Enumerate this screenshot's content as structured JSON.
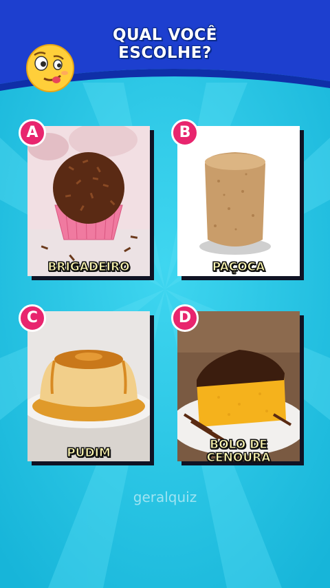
{
  "header": {
    "title_line1": "QUAL VOCÊ",
    "title_line2": "ESCOLHE?",
    "emoji_icon": "thinking-face-emoji"
  },
  "options": [
    {
      "letter": "A",
      "label": "BRIGADEIRO"
    },
    {
      "letter": "B",
      "label": "PAÇOCA"
    },
    {
      "letter": "C",
      "label": "PUDIM"
    },
    {
      "letter": "D",
      "label_line1": "BOLO DE",
      "label_line2": "CENOURA"
    }
  ],
  "watermark": "geralquiz",
  "colors": {
    "header_blue": "#1d3fcf",
    "background_cyan": "#23c6e6",
    "badge_pink": "#e8256e",
    "label_yellow": "#fff8b0"
  }
}
